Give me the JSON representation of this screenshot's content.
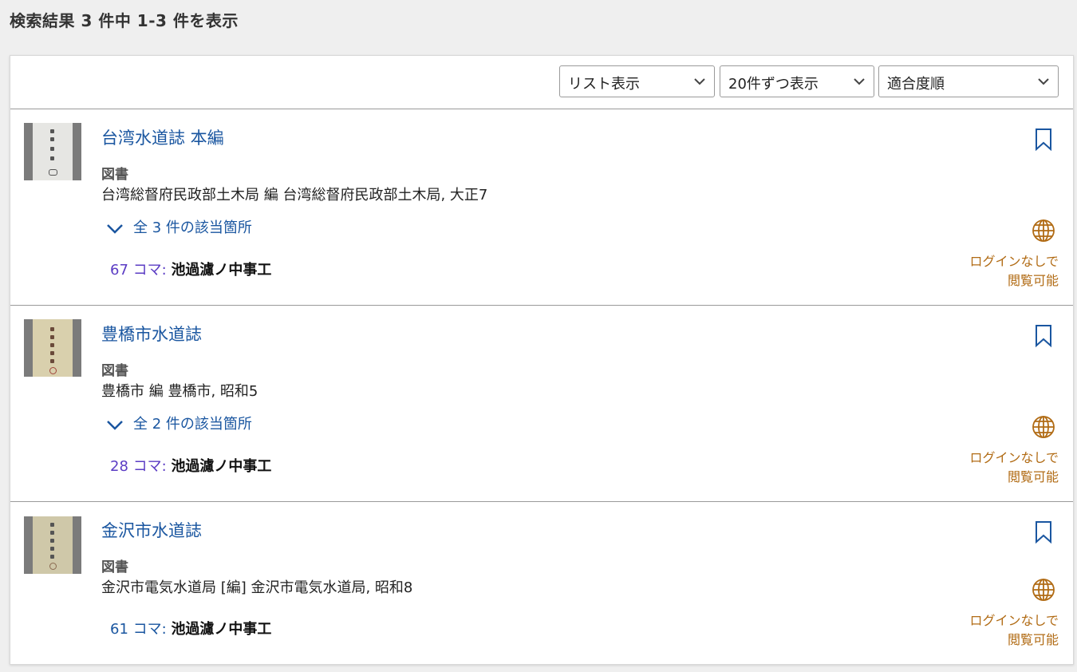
{
  "summary": "検索結果 3 件中 1-3 件を表示",
  "toolbar": {
    "view_select": "リスト表示",
    "count_select": "20件ずつ表示",
    "sort_select": "適合度順"
  },
  "results": [
    {
      "title": "台湾水道誌 本編",
      "type": "図書",
      "meta": "台湾総督府民政部土木局 編 台湾総督府民政部土木局, 大正7",
      "expand_label": "全 3 件の該当箇所",
      "hit_num": "67 コマ:",
      "hit_text": "池過濾ノ中事工",
      "access_line1": "ログインなしで",
      "access_line2": "閲覧可能"
    },
    {
      "title": "豊橋市水道誌",
      "type": "図書",
      "meta": "豊橋市 編 豊橋市, 昭和5",
      "expand_label": "全 2 件の該当箇所",
      "hit_num": "28 コマ:",
      "hit_text": "池過濾ノ中事工",
      "access_line1": "ログインなしで",
      "access_line2": "閲覧可能"
    },
    {
      "title": "金沢市水道誌",
      "type": "図書",
      "meta": "金沢市電気水道局 [編] 金沢市電気水道局, 昭和8",
      "hit_num": "61 コマ:",
      "hit_text": "池過濾ノ中事工",
      "access_line1": "ログインなしで",
      "access_line2": "閲覧可能"
    }
  ],
  "colors": {
    "link": "#1a56a0",
    "visited_num": "#5b3cc4",
    "access": "#b16b14",
    "background": "#efefef"
  },
  "icons": [
    "chevron-down-icon",
    "bookmark-icon",
    "globe-icon"
  ]
}
